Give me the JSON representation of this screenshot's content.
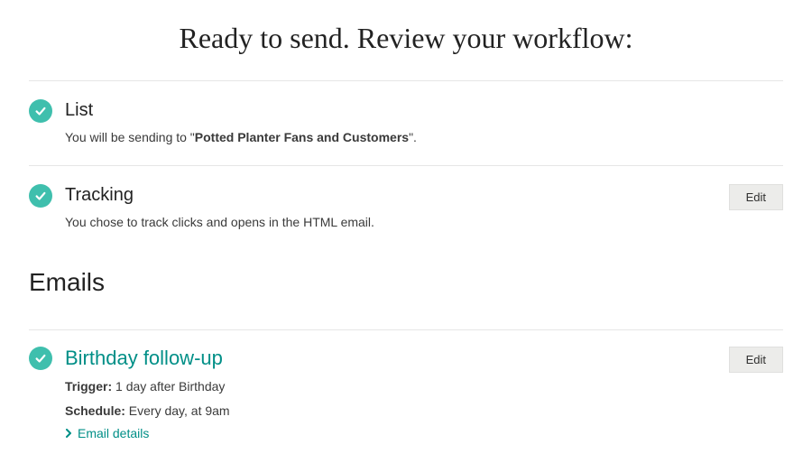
{
  "header": {
    "title": "Ready to send. Review your workflow:"
  },
  "sections": {
    "list": {
      "title": "List",
      "desc_prefix": "You will be sending to \"",
      "desc_bold": "Potted Planter Fans and Customers",
      "desc_suffix": "\"."
    },
    "tracking": {
      "title": "Tracking",
      "desc": "You chose to track clicks and opens in the HTML email.",
      "edit_label": "Edit"
    }
  },
  "emails": {
    "heading": "Emails",
    "items": [
      {
        "title": "Birthday follow-up",
        "trigger_label": "Trigger:",
        "trigger_value": " 1 day after Birthday",
        "schedule_label": "Schedule:",
        "schedule_value": " Every day, at 9am",
        "details_label": "Email details",
        "edit_label": "Edit"
      }
    ]
  }
}
